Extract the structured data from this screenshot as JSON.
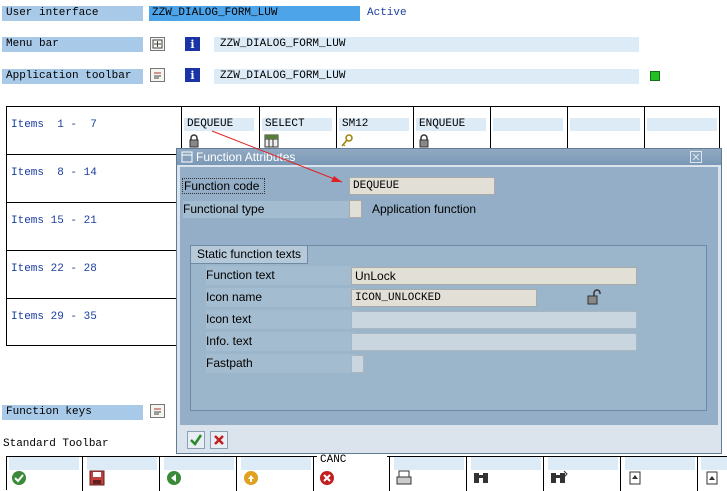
{
  "header": {
    "rows": [
      {
        "label": "User interface",
        "value": "ZZW_DIALOG_FORM_LUW",
        "status": "Active"
      },
      {
        "label": "Menu bar",
        "value": "ZZW_DIALOG_FORM_LUW"
      },
      {
        "label": "Application toolbar",
        "value": "ZZW_DIALOG_FORM_LUW"
      }
    ],
    "status_color": "#22c022"
  },
  "items_grid": {
    "rows": [
      "Items  1 -  7",
      "Items  8 - 14",
      "Items 15 - 21",
      "Items 22 - 28",
      "Items 29 - 35"
    ],
    "first_row_codes": [
      "DEQUEUE",
      "SELECT",
      "SM12",
      "ENQUEUE",
      "",
      "",
      ""
    ],
    "first_row_icons": [
      "lock-icon",
      "table-icon",
      "key-icon",
      "lock-icon"
    ]
  },
  "function_keys": {
    "label": "Function keys",
    "standard_toolbar_label": "Standard Toolbar",
    "toolbar_codes": [
      "",
      "",
      "",
      "",
      "CANC",
      "",
      "",
      "",
      "",
      ""
    ],
    "toolbar_icons": [
      "check-icon",
      "save-icon",
      "back-icon",
      "exit-icon",
      "cancel-icon",
      "print-icon",
      "find-icon",
      "find-next-icon",
      "first-page-icon",
      "prev-page-icon"
    ]
  },
  "dialog": {
    "title": "Function Attributes",
    "function_code_label": "Function code",
    "function_code_value": "DEQUEUE",
    "functional_type_label": "Functional type",
    "functional_type_value": "Application function",
    "group_title": "Static function texts",
    "fields": [
      {
        "label": "Function text",
        "value": "UnLock"
      },
      {
        "label": "Icon name",
        "value": "ICON_UNLOCKED"
      },
      {
        "label": "Icon text",
        "value": ""
      },
      {
        "label": "Info. text",
        "value": ""
      },
      {
        "label": "Fastpath",
        "value": ""
      }
    ],
    "confirm_icon": "check-icon",
    "cancel_icon": "cancel-icon",
    "accent_color": "#7a98b6",
    "arrow_color": "#e02020"
  }
}
